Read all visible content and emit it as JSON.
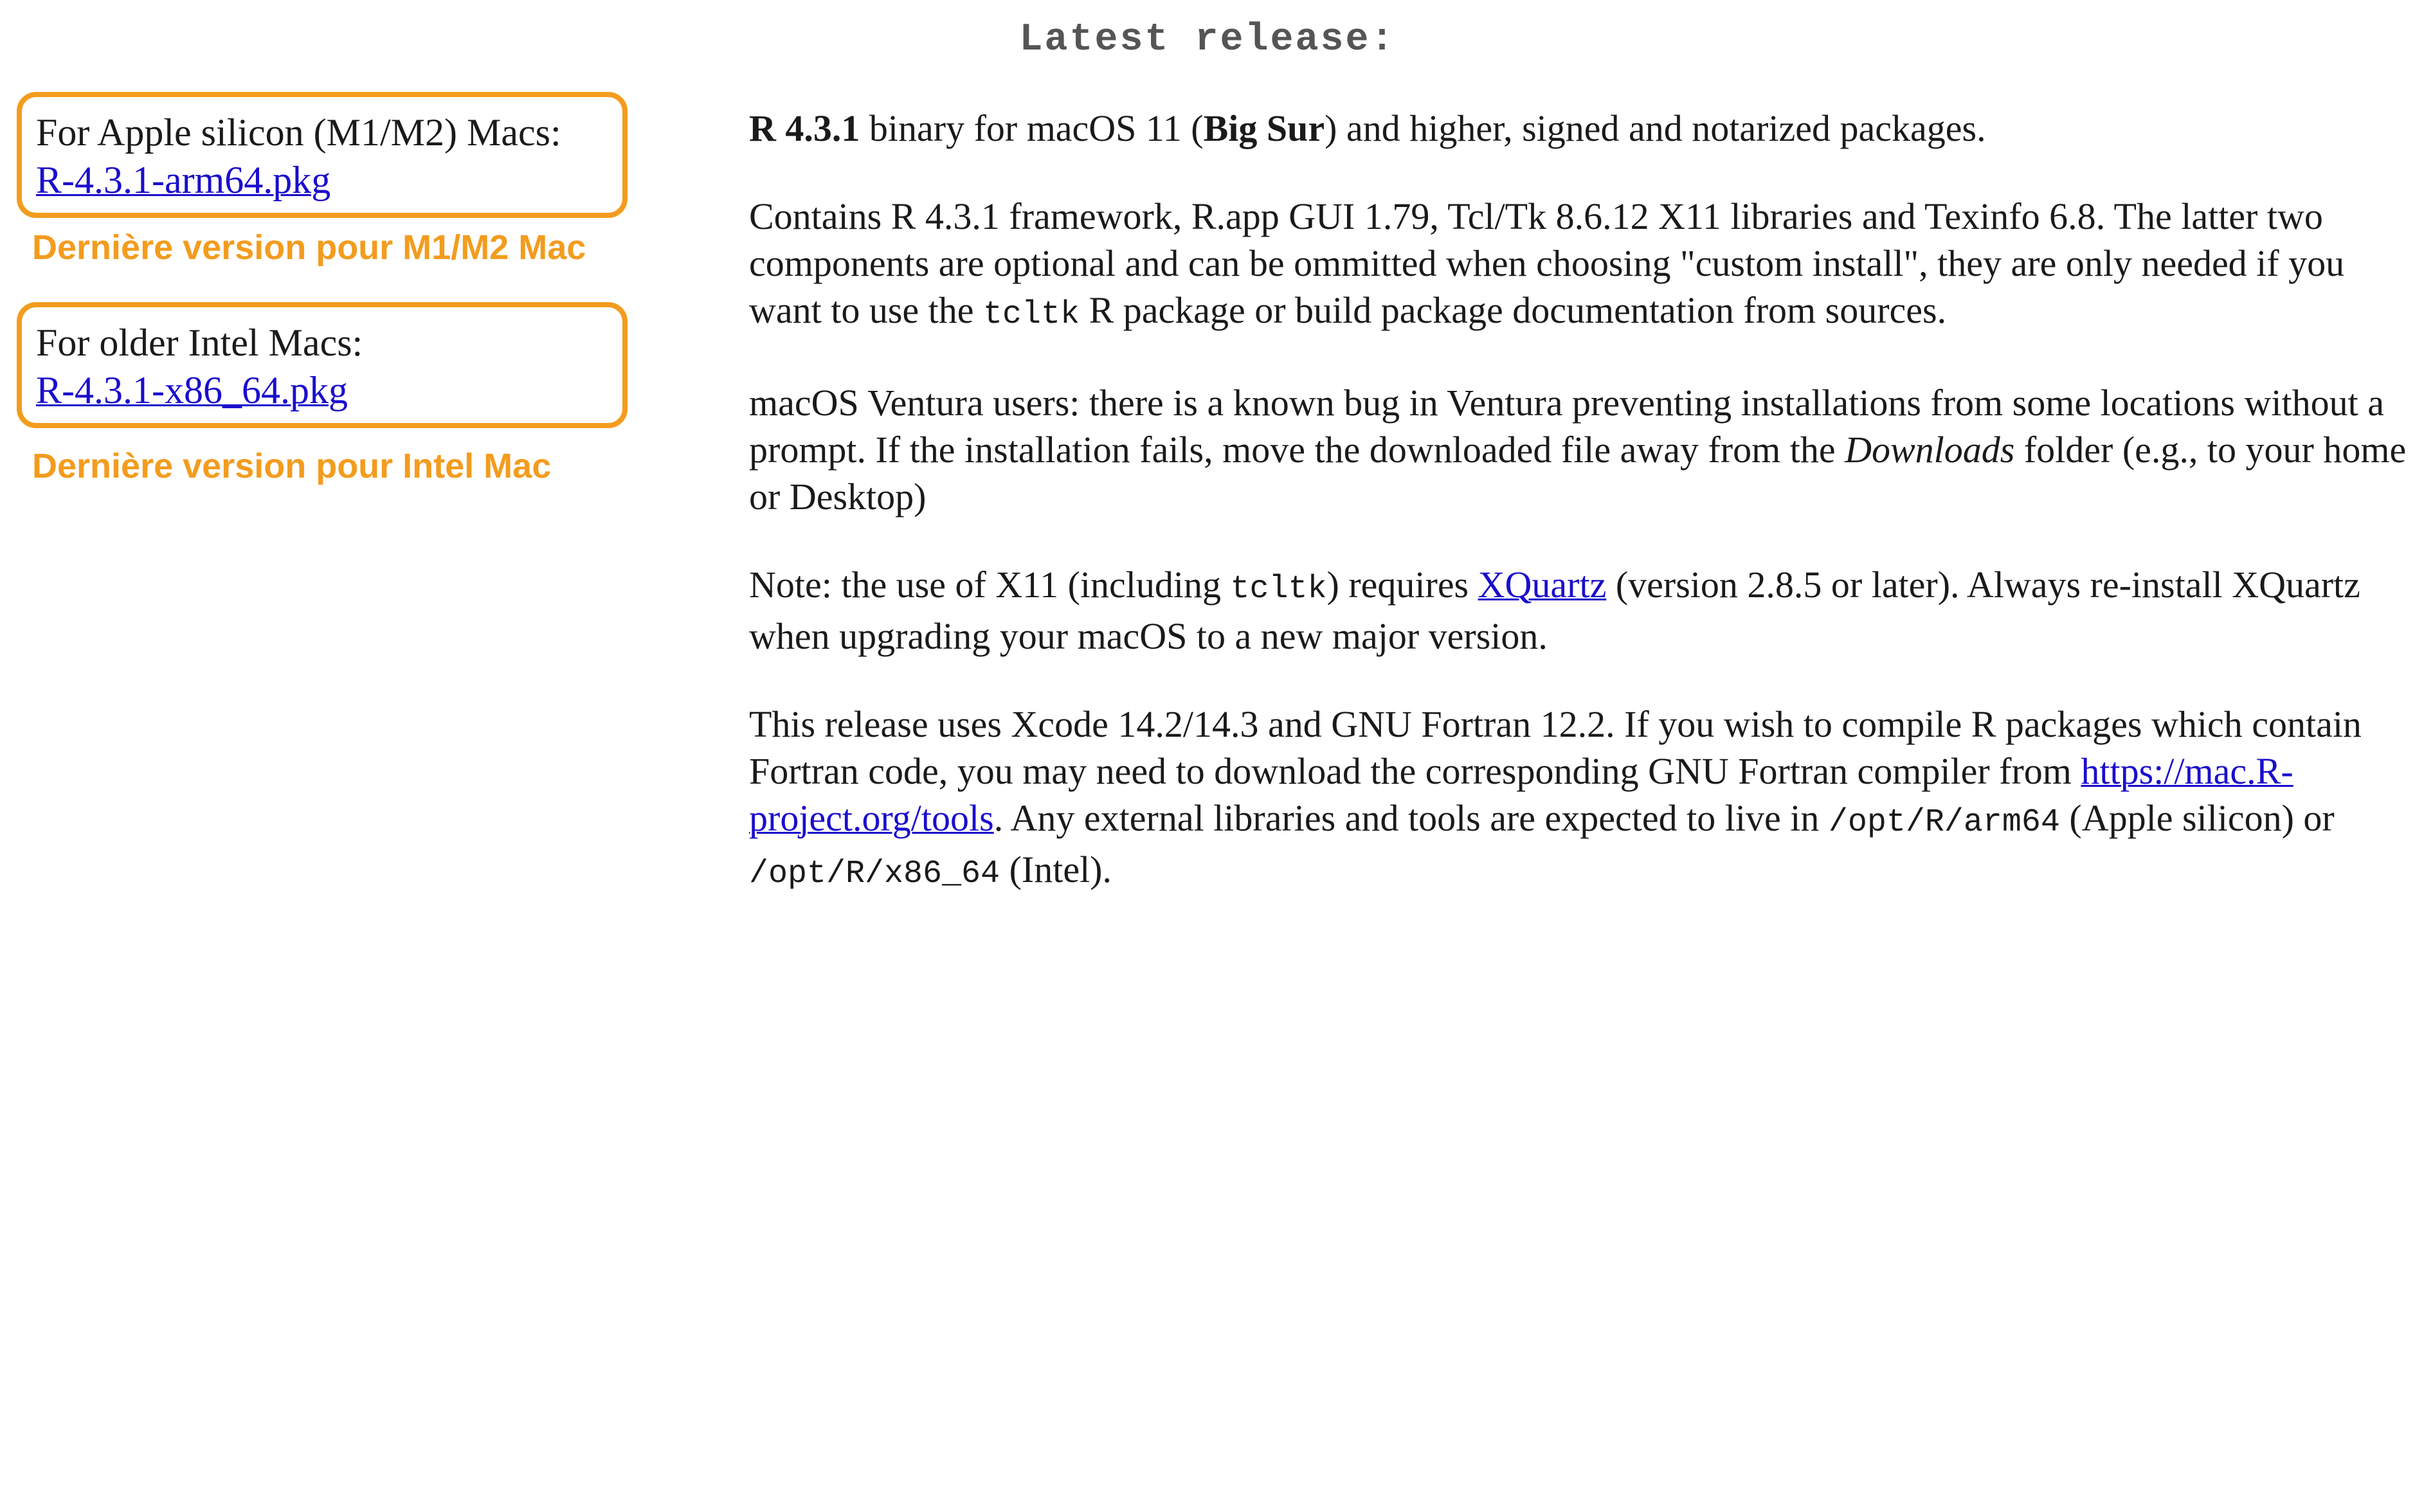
{
  "heading": "Latest release:",
  "downloads": [
    {
      "label": "For Apple silicon (M1/M2) Macs:",
      "file": "R-4.3.1-arm64.pkg",
      "note": "Dernière version pour M1/M2 Mac"
    },
    {
      "label": "For older Intel Macs:",
      "file": "R-4.3.1-x86_64.pkg",
      "note": "Dernière version pour Intel Mac"
    }
  ],
  "release": {
    "version": "R 4.3.1",
    "line1_a": " binary for macOS 11 (",
    "codename": "Big Sur",
    "line1_b": ") and higher, signed and notarized packages."
  },
  "contains": {
    "text_a": "Contains R 4.3.1 framework, R.app GUI 1.79, Tcl/Tk 8.6.12 X11 libraries and Texinfo 6.8. The latter two components are optional and can be ommitted when choosing \"custom install\", they are only needed if you want to use the ",
    "code": "tcltk",
    "text_b": " R package or build package documentation from sources."
  },
  "ventura": {
    "text_a": "macOS Ventura users: there is a known bug in Ventura preventing installations from some locations without a prompt. If the installation fails, move the downloaded file away from the ",
    "emph": "Downloads",
    "text_b": " folder (e.g., to your home or Desktop)"
  },
  "note": {
    "text_a": "Note: the use of X11 (including ",
    "code": "tcltk",
    "text_b": ") requires ",
    "link": "XQuartz",
    "text_c": " (version 2.8.5 or later). Always re-install XQuartz when upgrading your macOS to a new major version."
  },
  "xcode": {
    "text_a": "This release uses Xcode 14.2/14.3 and GNU Fortran 12.2. If you wish to compile R packages which contain Fortran code, you may need to download the corresponding GNU Fortran compiler from ",
    "link": "https://mac.R-project.org/tools",
    "text_b": ". Any external libraries and tools are expected to live in ",
    "path1": "/opt/R/arm64",
    "text_c": " (Apple silicon) or ",
    "path2": "/opt/R/x86_64",
    "text_d": " (Intel)."
  }
}
